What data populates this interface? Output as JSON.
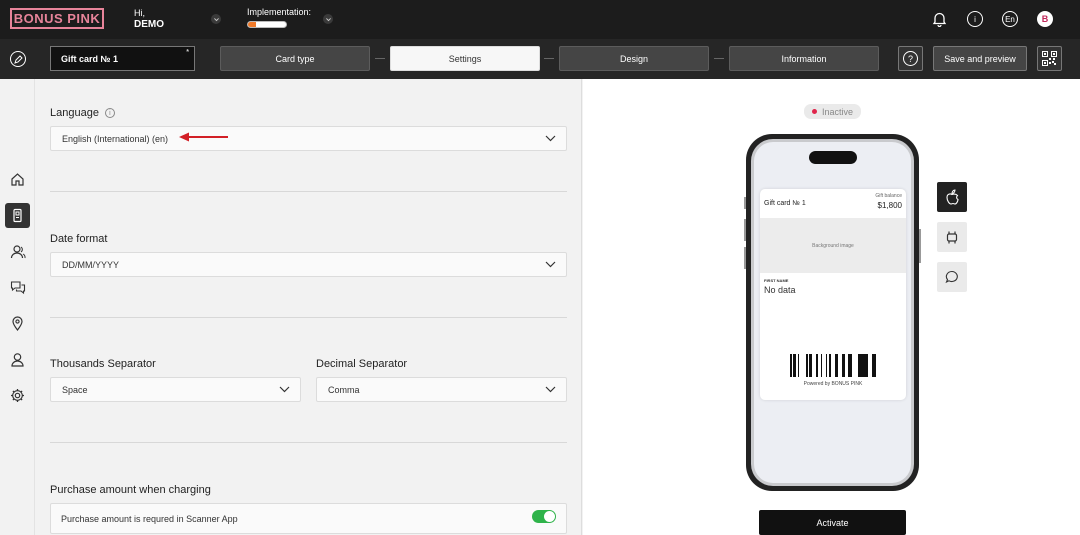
{
  "header": {
    "logo": "BONUS PINK",
    "greeting": "Hi,",
    "user": "DEMO",
    "implementation_label": "Implementation:",
    "implementation_progress": 0.2,
    "lang_badge": "En",
    "avatar_letter": "B"
  },
  "toolbar": {
    "card_name": "Gift card № 1",
    "card_name_marker": "*",
    "steps": [
      "Card type",
      "Settings",
      "Design",
      "Information"
    ],
    "active_step": "Settings",
    "help": "?",
    "save_preview": "Save and preview"
  },
  "settings": {
    "language_label": "Language",
    "language_value": "English (International) (en)",
    "date_label": "Date format",
    "date_value": "DD/MM/YYYY",
    "thousands_label": "Thousands Separator",
    "thousands_value": "Space",
    "decimal_label": "Decimal Separator",
    "decimal_value": "Comma",
    "purchase_label": "Purchase amount when charging",
    "purchase_toggle_text": "Purchase amount is requred in Scanner App",
    "purchase_toggle_on": true
  },
  "preview": {
    "status": "Inactive",
    "status_color": "#e0254b",
    "pass_title": "Gift card № 1",
    "balance_label": "Gift balance",
    "balance_value": "$1,800",
    "background_text": "Background image",
    "field_label": "FIRST NAME",
    "field_value": "No data",
    "powered": "Powered by BONUS PINK",
    "activate": "Activate"
  },
  "colors": {
    "accent_pink": "#e7849a",
    "toggle_green": "#2fb34a",
    "progress_orange": "#f07a2a"
  }
}
